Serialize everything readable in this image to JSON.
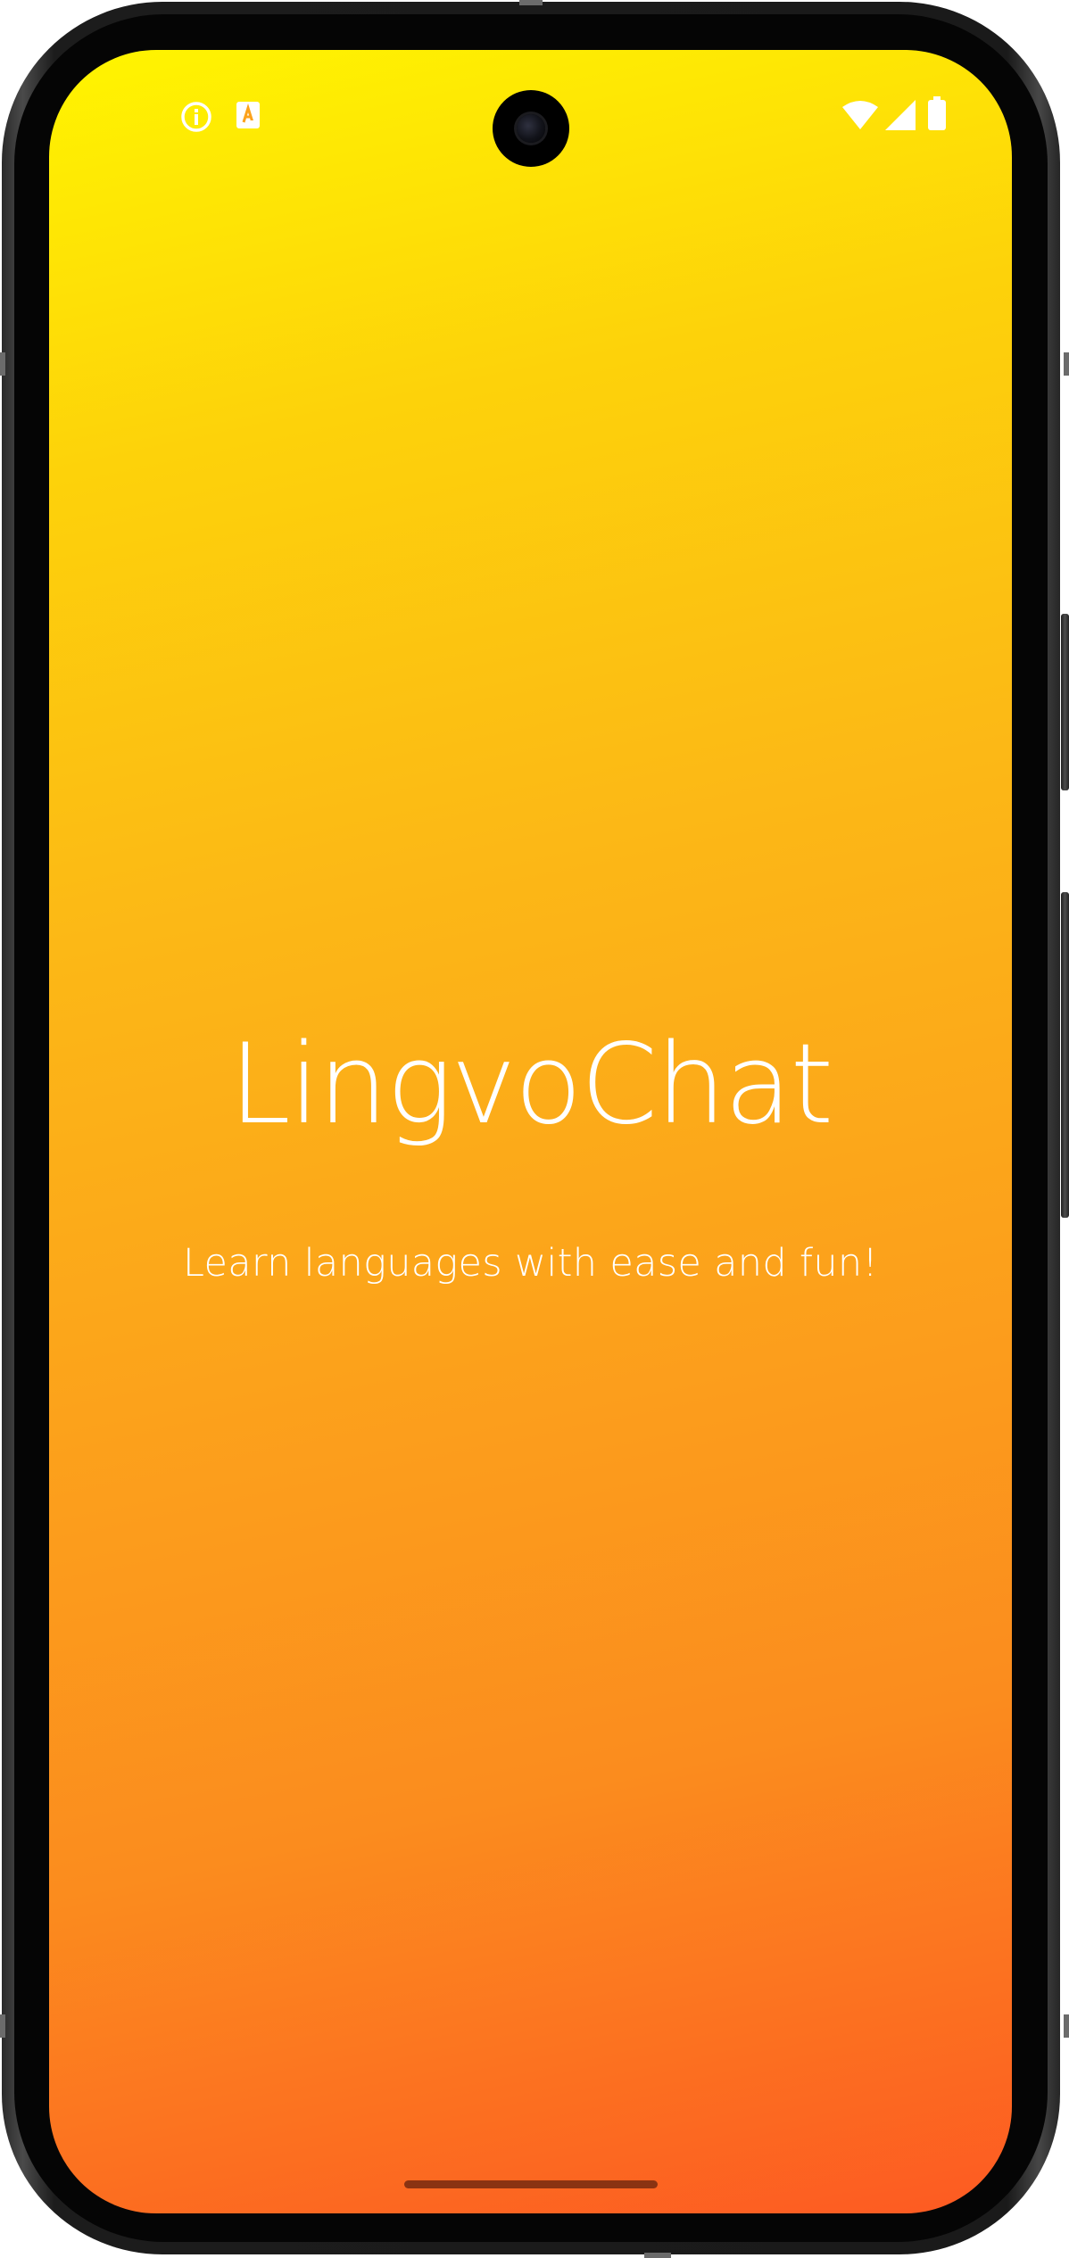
{
  "app": {
    "title": "LingvoChat",
    "tagline": "Learn languages with ease and fun!"
  },
  "status_bar": {
    "left_icons": [
      "info-icon",
      "translate-icon"
    ],
    "right_icons": [
      "wifi-icon",
      "cellular-signal-icon",
      "battery-icon"
    ]
  },
  "colors": {
    "gradient_start": "#fff500",
    "gradient_end": "#fd5a22",
    "text": "#ffffff"
  }
}
